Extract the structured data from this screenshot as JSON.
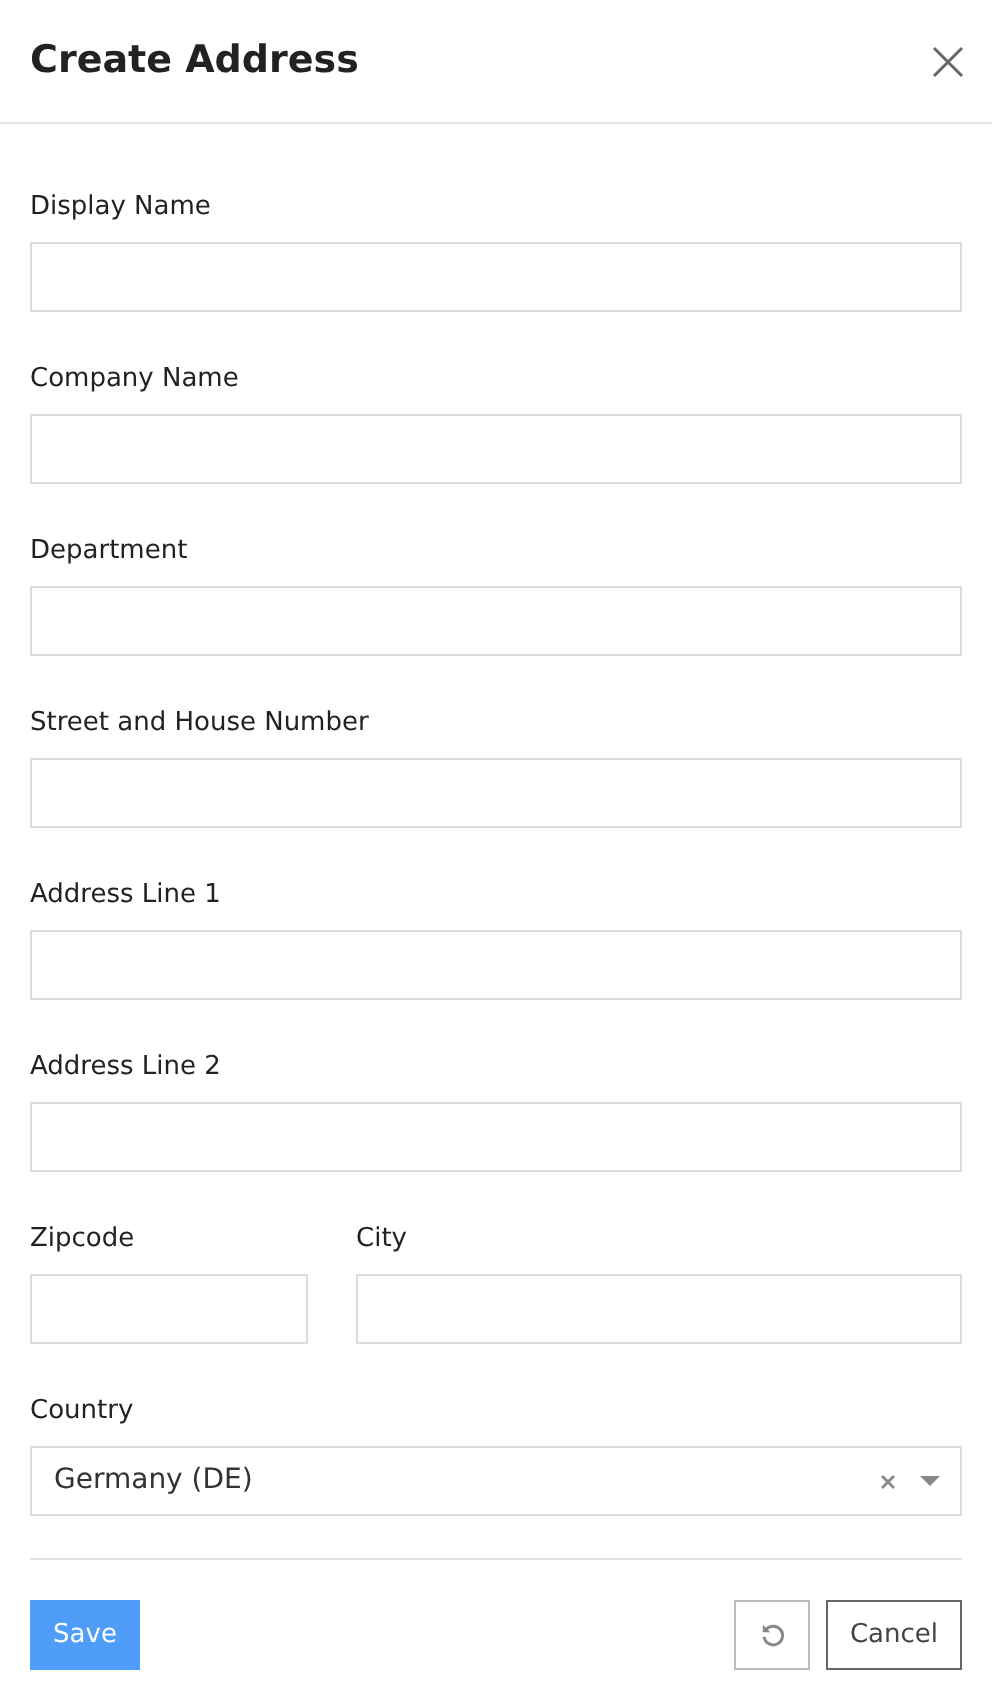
{
  "dialog": {
    "title": "Create Address"
  },
  "rows": [
    {
      "fields": [
        {
          "label": "Display Name",
          "kind": "text"
        }
      ]
    },
    {
      "fields": [
        {
          "label": "Company Name",
          "kind": "text"
        }
      ]
    },
    {
      "fields": [
        {
          "label": "Department",
          "kind": "text"
        }
      ]
    },
    {
      "fields": [
        {
          "label": "Street and House Number",
          "kind": "text"
        }
      ]
    },
    {
      "fields": [
        {
          "label": "Address Line 1",
          "kind": "text"
        }
      ]
    },
    {
      "fields": [
        {
          "label": "Address Line 2",
          "kind": "text"
        }
      ]
    },
    {
      "fields": [
        {
          "label": "Zipcode",
          "kind": "text"
        },
        {
          "label": "City",
          "kind": "text"
        }
      ]
    },
    {
      "fields": [
        {
          "label": "Country",
          "kind": "select",
          "value": "Germany (DE)"
        }
      ]
    }
  ],
  "buttons": {
    "save": "Save",
    "cancel": "Cancel"
  }
}
